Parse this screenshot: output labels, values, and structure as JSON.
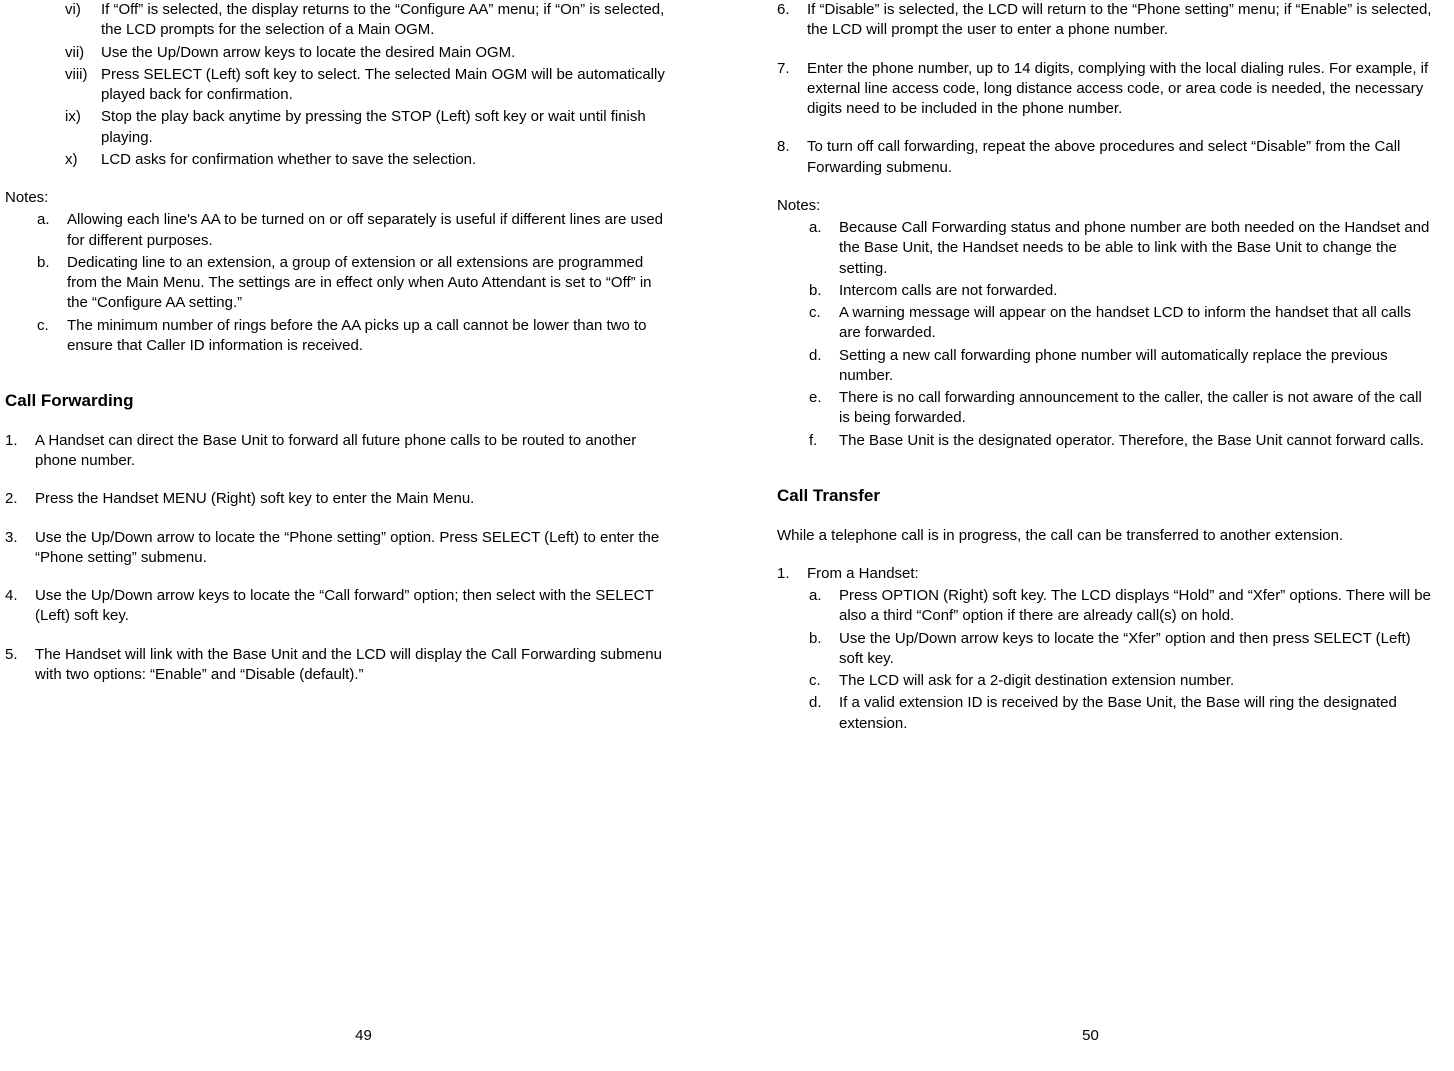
{
  "left": {
    "roman": [
      {
        "mk": "vi)",
        "tx": "If “Off” is selected, the display returns to the “Configure AA” menu; if “On” is selected, the LCD prompts for the selection of a Main OGM."
      },
      {
        "mk": "vii)",
        "tx": "Use the Up/Down arrow keys to locate the desired Main OGM."
      },
      {
        "mk": "viii)",
        "tx": "Press SELECT (Left) soft key to select.  The selected Main OGM will be automatically played back for confirmation."
      },
      {
        "mk": "ix)",
        "tx": "Stop the play back anytime by pressing the STOP (Left) soft key or wait until finish playing."
      },
      {
        "mk": "x)",
        "tx": "LCD asks for confirmation whether to save the selection."
      }
    ],
    "notes_label": "Notes:",
    "notes": [
      {
        "mk": "a.",
        "tx": "Allowing each line's AA to be turned on or off separately is useful if different lines are used for different purposes."
      },
      {
        "mk": "b.",
        "tx": "Dedicating line to an extension, a group of extension or all extensions are programmed from the Main Menu.  The settings are in effect only when Auto Attendant is set to “Off” in the “Configure AA setting.”"
      },
      {
        "mk": "c.",
        "tx": "The minimum number of rings before the AA picks up a call cannot be lower than two to ensure that Caller ID information is received."
      }
    ],
    "heading": "Call Forwarding",
    "steps": [
      {
        "mk": "1.",
        "tx": "A Handset can direct the Base Unit to forward all future phone calls to be routed to another phone number."
      },
      {
        "mk": "2.",
        "tx": "Press the Handset MENU (Right) soft key to enter the Main Menu."
      },
      {
        "mk": "3.",
        "tx": "Use the Up/Down arrow to locate the “Phone setting” option.  Press SELECT (Left) to enter the “Phone setting” submenu."
      },
      {
        "mk": "4.",
        "tx": "Use the Up/Down arrow keys to locate the “Call forward” option; then select with the SELECT (Left) soft key."
      },
      {
        "mk": "5.",
        "tx": "The Handset will link with the Base Unit and the LCD will display the Call Forwarding submenu with two options: “Enable” and “Disable (default).”"
      }
    ],
    "pagenum": "49"
  },
  "right": {
    "steps_cont": [
      {
        "mk": "6.",
        "tx": "If “Disable” is selected, the LCD will return to the “Phone setting” menu; if “Enable” is selected, the LCD will prompt the user to enter a phone number."
      },
      {
        "mk": "7.",
        "tx": "Enter the phone number, up to 14 digits, complying with the local dialing rules.  For example, if external line access code, long distance access code, or area code is needed, the necessary digits need to be included in the phone number."
      },
      {
        "mk": "8.",
        "tx": "To turn off call forwarding, repeat the above procedures and select “Disable” from the Call Forwarding submenu."
      }
    ],
    "notes_label": "Notes:",
    "notes": [
      {
        "mk": "a.",
        "tx": "Because Call Forwarding status and phone number are both needed on the Handset and the Base Unit, the Handset needs to be able to link with the Base Unit to change the setting."
      },
      {
        "mk": "b.",
        "tx": "Intercom calls are not forwarded."
      },
      {
        "mk": "c.",
        "tx": "A warning message will appear on the handset LCD to inform the handset that all calls are forwarded."
      },
      {
        "mk": "d.",
        "tx": "Setting a new call forwarding phone number will automatically replace the previous number."
      },
      {
        "mk": "e.",
        "tx": "There is no call forwarding announcement to the caller, the caller is not aware of the call is being forwarded."
      },
      {
        "mk": "f.",
        "tx": "The Base Unit is the designated operator.  Therefore, the Base Unit cannot forward calls."
      }
    ],
    "heading": "Call Transfer",
    "intro": "While a telephone call is in progress, the call can be transferred to another extension.",
    "step1": {
      "mk": "1.",
      "tx": "From a Handset:"
    },
    "sub": [
      {
        "mk": "a.",
        "tx": "Press OPTION (Right) soft key.  The LCD displays “Hold” and “Xfer” options.  There will be also a third “Conf” option if there are already call(s) on hold."
      },
      {
        "mk": "b.",
        "tx": "Use the Up/Down arrow keys to locate the “Xfer” option and then press SELECT (Left) soft key."
      },
      {
        "mk": "c.",
        "tx": "The LCD will ask for a 2-digit destination extension number."
      },
      {
        "mk": "d.",
        "tx": "If a valid extension ID is received by the Base Unit, the Base will ring the designated extension."
      }
    ],
    "pagenum": "50"
  }
}
